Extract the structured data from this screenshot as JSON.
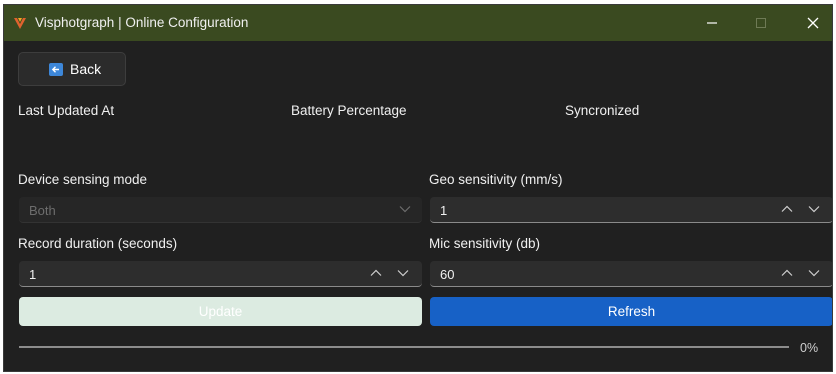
{
  "window": {
    "title": "Visphotgraph | Online Configuration",
    "titlebar_color": "#3a4a20"
  },
  "back_button": {
    "label": "Back",
    "icon": "back-arrow-icon"
  },
  "info": {
    "last_updated_label": "Last Updated At",
    "battery_label": "Battery Percentage",
    "synchronized_label": "Syncronized"
  },
  "settings": {
    "sensing_mode": {
      "label": "Device sensing mode",
      "value": "Both",
      "disabled": true
    },
    "geo_sensitivity": {
      "label": "Geo sensitivity (mm/s)",
      "value": "1"
    },
    "record_duration": {
      "label": "Record duration (seconds)",
      "value": "1"
    },
    "mic_sensitivity": {
      "label": "Mic sensitivity (db)",
      "value": "60"
    }
  },
  "actions": {
    "update_label": "Update",
    "refresh_label": "Refresh",
    "accent": "#1761c6"
  },
  "progress": {
    "value": 0,
    "text": "0%"
  }
}
